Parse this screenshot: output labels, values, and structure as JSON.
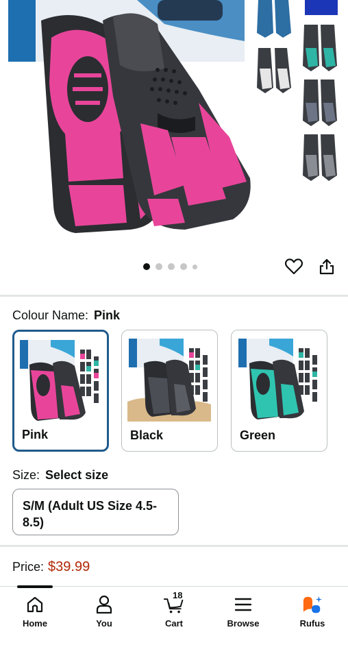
{
  "gallery": {
    "dots": 5,
    "active_dot": 0,
    "icons": [
      "heart-icon",
      "share-icon"
    ]
  },
  "colour": {
    "label": "Colour Name:",
    "selected_value": "Pink",
    "options": [
      {
        "label": "Pink",
        "selected": true
      },
      {
        "label": "Black",
        "selected": false
      },
      {
        "label": "Green",
        "selected": false
      }
    ]
  },
  "size": {
    "label": "Size:",
    "selected_value": "Select size",
    "options": [
      {
        "label": "S/M (Adult US Size 4.5-8.5)"
      }
    ]
  },
  "price": {
    "label": "Price:",
    "value": "$39.99"
  },
  "colors": {
    "accent_price": "#b12704",
    "selected_border": "#1f5a8c",
    "fin_pink": "#e8459a",
    "fin_dark": "#2b2d31",
    "rufus_orange": "#ff6a13",
    "rufus_blue": "#1a73e8"
  },
  "nav": {
    "items": [
      {
        "label": "Home",
        "icon": "home-icon",
        "active": true
      },
      {
        "label": "You",
        "icon": "user-icon"
      },
      {
        "label": "Cart",
        "icon": "cart-icon",
        "count": "18"
      },
      {
        "label": "Browse",
        "icon": "menu-icon"
      },
      {
        "label": "Rufus",
        "icon": "rufus-icon"
      }
    ]
  }
}
